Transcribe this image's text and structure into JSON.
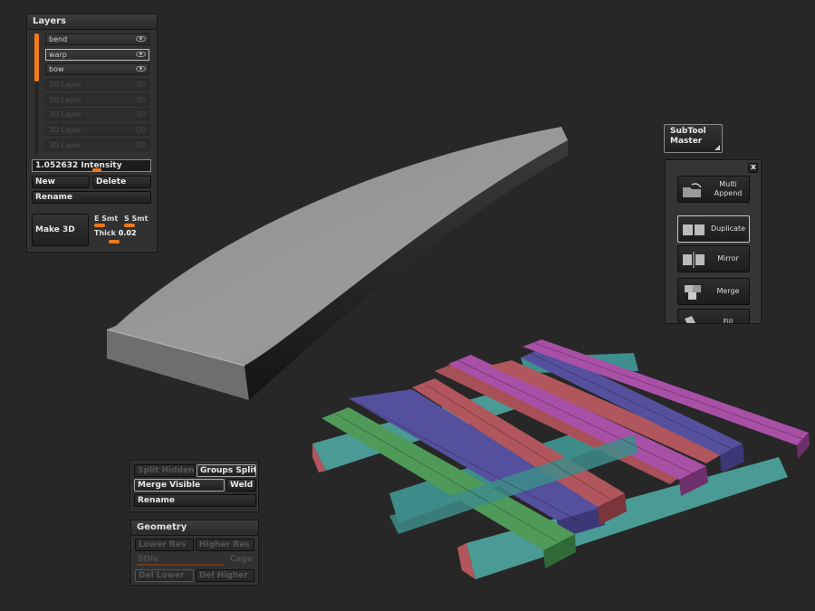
{
  "layers_panel": {
    "title": "Layers",
    "layers": [
      {
        "name": "bend",
        "state": "active"
      },
      {
        "name": "warp",
        "state": "selected"
      },
      {
        "name": "bow",
        "state": "active"
      },
      {
        "name": "3D Layer",
        "state": "empty"
      },
      {
        "name": "3D Layer",
        "state": "empty"
      },
      {
        "name": "3D Layer",
        "state": "empty"
      },
      {
        "name": "3D Layer",
        "state": "empty"
      },
      {
        "name": "3D Layer",
        "state": "empty"
      }
    ],
    "intensity_label": "1.052632 Intensity",
    "intensity_fraction": 0.52,
    "new_label": "New",
    "delete_label": "Delete",
    "rename_label": "Rename",
    "make3d_label": "Make 3D",
    "esmt_label": "E Smt",
    "ssmt_label": "S Smt",
    "thick_label": "Thick",
    "thick_value": "0.02",
    "accent_color": "#f07a1a"
  },
  "subtool_master": {
    "button_label": "SubTool Master",
    "close_label": "x",
    "buttons": [
      {
        "label": "Multi Append",
        "icon": "folder-append-icon"
      },
      {
        "label": "Duplicate",
        "icon": "duplicate-cubes-icon"
      },
      {
        "label": "Mirror",
        "icon": "mirror-cubes-icon"
      },
      {
        "label": "Merge",
        "icon": "merge-cubes-icon"
      },
      {
        "label": "Fill",
        "icon": "fill-bucket-icon"
      }
    ]
  },
  "subtool_panel": {
    "split_hidden_label": "Split Hidden",
    "groups_split_label": "Groups Split",
    "merge_visible_label": "Merge Visible",
    "weld_label": "Weld",
    "rename_label": "Rename"
  },
  "geometry_panel": {
    "title": "Geometry",
    "lower_res_label": "Lower Res",
    "higher_res_label": "Higher Res",
    "sdiv_label": "SDiv",
    "cage_label": "Cage",
    "del_lower_label": "Del Lower",
    "del_higher_label": "Del Higher"
  },
  "viewport": {
    "background_color": "#272727",
    "mesh_colors": [
      "#a84fa6",
      "#55509e",
      "#b0565c",
      "#4f9a58",
      "#3f8f8f"
    ]
  }
}
